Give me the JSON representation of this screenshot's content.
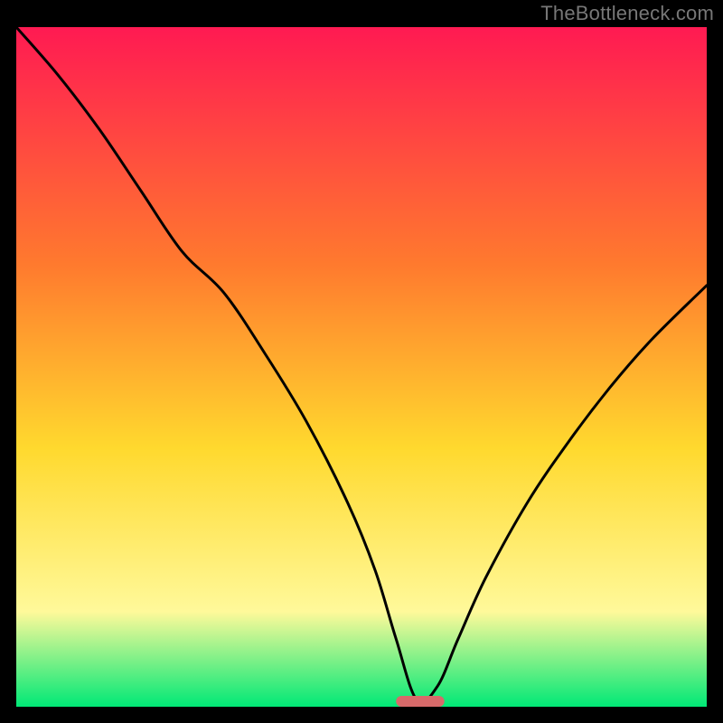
{
  "watermark": "TheBottleneck.com",
  "colors": {
    "frame_bg": "#000000",
    "gradient_top": "#ff1a52",
    "gradient_mid1": "#ff7a2e",
    "gradient_mid2": "#ffd92e",
    "gradient_mid3": "#fff99a",
    "gradient_bottom": "#00e876",
    "curve_stroke": "#000000",
    "marker_fill": "#d76a6a",
    "watermark_text": "#777777"
  },
  "chart_data": {
    "type": "line",
    "title": "",
    "xlabel": "",
    "ylabel": "",
    "xlim": [
      0,
      100
    ],
    "ylim": [
      0,
      100
    ],
    "grid": false,
    "legend": null,
    "annotations": [],
    "optimum_x": 58,
    "marker": {
      "x_start": 55,
      "x_end": 62,
      "y": 0.8
    },
    "series": [
      {
        "name": "bottleneck_curve",
        "x": [
          0,
          6,
          12,
          18,
          24,
          30,
          36,
          42,
          48,
          52,
          55,
          58,
          61,
          64,
          68,
          74,
          80,
          86,
          92,
          100
        ],
        "y": [
          100,
          93,
          85,
          76,
          67,
          61,
          52,
          42,
          30,
          20,
          10,
          1,
          3,
          10,
          19,
          30,
          39,
          47,
          54,
          62
        ]
      }
    ]
  }
}
